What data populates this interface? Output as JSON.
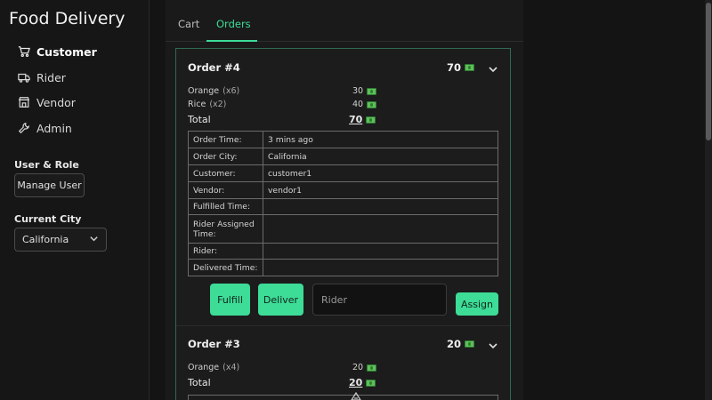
{
  "app": {
    "title": "Food Delivery"
  },
  "sidebar": {
    "nav": [
      {
        "label": "Customer",
        "icon": "cart-icon",
        "active": true
      },
      {
        "label": "Rider",
        "icon": "truck-icon",
        "active": false
      },
      {
        "label": "Vendor",
        "icon": "store-icon",
        "active": false
      },
      {
        "label": "Admin",
        "icon": "wrench-icon",
        "active": false
      }
    ],
    "user_role_label": "User & Role",
    "manage_user_label": "Manage User",
    "current_city_label": "Current City",
    "city_value": "California"
  },
  "tabs": [
    {
      "label": "Cart",
      "active": false
    },
    {
      "label": "Orders",
      "active": true
    }
  ],
  "orders": [
    {
      "title": "Order #4",
      "total": "70",
      "items": [
        {
          "name": "Orange",
          "qty": "(x6)",
          "price": "30"
        },
        {
          "name": "Rice",
          "qty": "(x2)",
          "price": "40"
        }
      ],
      "total_label": "Total",
      "total_value": "70",
      "details": [
        {
          "key": "Order Time:",
          "value": "3 mins ago"
        },
        {
          "key": "Order City:",
          "value": "California"
        },
        {
          "key": "Customer:",
          "value": "customer1"
        },
        {
          "key": "Vendor:",
          "value": "vendor1"
        },
        {
          "key": "Fulfilled Time:",
          "value": ""
        },
        {
          "key": "Rider Assigned Time:",
          "value": ""
        },
        {
          "key": "Rider:",
          "value": ""
        },
        {
          "key": "Delivered Time:",
          "value": ""
        }
      ],
      "actions": {
        "fulfill_label": "Fulfill",
        "deliver_label": "Deliver",
        "rider_placeholder": "Rider",
        "assign_label": "Assign"
      }
    },
    {
      "title": "Order #3",
      "total": "20",
      "items": [
        {
          "name": "Orange",
          "qty": "(x4)",
          "price": "20"
        }
      ],
      "total_label": "Total",
      "total_value": "20"
    }
  ],
  "colors": {
    "accent": "#3ddc97",
    "background": "#141414",
    "panel": "#1a1a1a",
    "border_accent": "#2f6b52"
  }
}
